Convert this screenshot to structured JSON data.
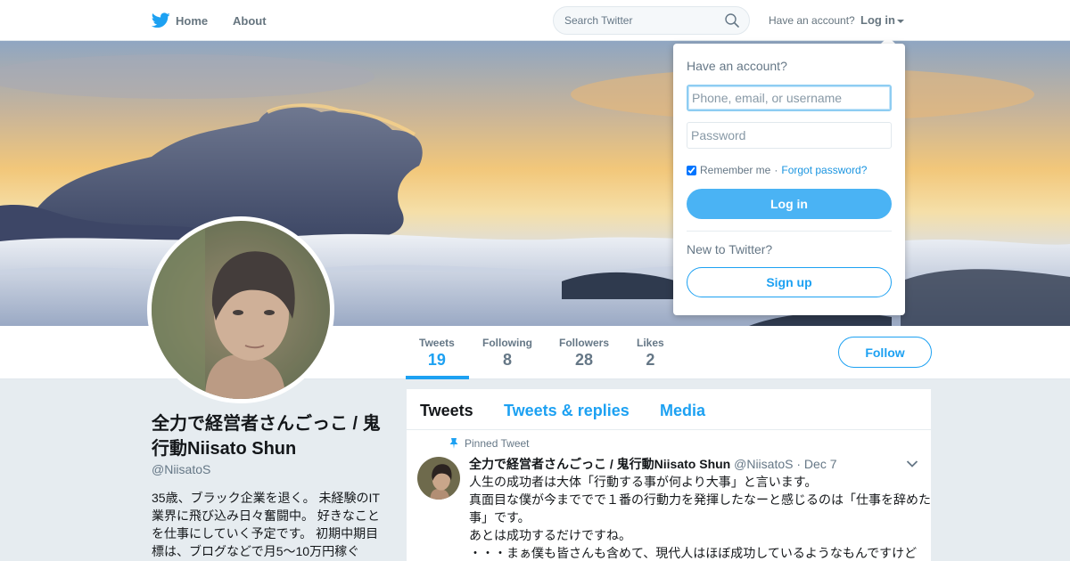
{
  "nav": {
    "home": "Home",
    "about": "About",
    "search_placeholder": "Search Twitter",
    "have_account": "Have an account?",
    "login": "Log in"
  },
  "stats": [
    {
      "label": "Tweets",
      "value": "19"
    },
    {
      "label": "Following",
      "value": "8"
    },
    {
      "label": "Followers",
      "value": "28"
    },
    {
      "label": "Likes",
      "value": "2"
    }
  ],
  "follow_label": "Follow",
  "profile": {
    "name": "全力で経営者さんごっこ / 鬼行動Niisato Shun",
    "handle": "@NiisatoS",
    "bio": "35歳、ブラック企業を退く。 未経験のIT業界に飛び込み日々奮闘中。 好きなことを仕事にしていく予定です。 初期中期目標は、ブログなどで月5〜10万円稼ぐ"
  },
  "timeline": {
    "tabs": [
      "Tweets",
      "Tweets & replies",
      "Media"
    ],
    "pinned_label": "Pinned Tweet",
    "tweet": {
      "name": "全力で経営者さんごっこ / 鬼行動Niisato Shun",
      "handle": "@NiisatoS",
      "sep": "·",
      "date": "Dec 7",
      "lines": [
        "人生の成功者は大体「行動する事が何より大事」と言います。",
        "真面目な僕が今まででで１番の行動力を発揮したなーと感じるのは「仕事を辞めた",
        "事」です。",
        "あとは成功するだけですね。",
        "・・・まぁ僕も皆さんも含めて、現代人はほぼ成功しているようなもんですけど"
      ]
    }
  },
  "login_dropdown": {
    "title": "Have an account?",
    "username_placeholder": "Phone, email, or username",
    "password_placeholder": "Password",
    "remember": "Remember me",
    "sep": "·",
    "forgot": "Forgot password?",
    "login_button": "Log in",
    "new_to": "New to Twitter?",
    "signup_button": "Sign up"
  },
  "colors": {
    "accent": "#1da1f2",
    "login_button": "#4ab3f4",
    "background": "#e6ecf0"
  },
  "icons": [
    "twitter-bird-icon",
    "search-icon",
    "pin-icon",
    "chevron-down-icon"
  ]
}
